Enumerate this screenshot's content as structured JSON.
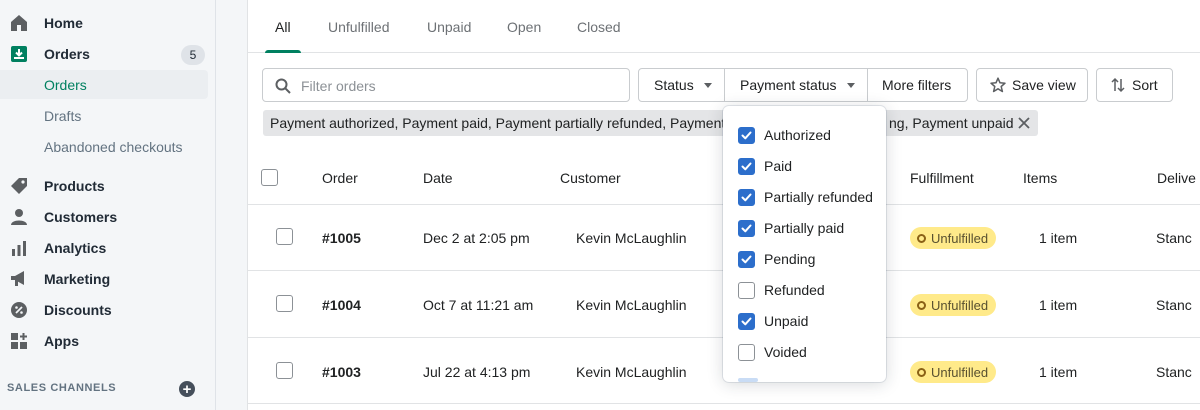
{
  "sidebar": {
    "items": [
      {
        "icon": "home-icon",
        "label": "Home"
      },
      {
        "icon": "orders-icon",
        "label": "Orders",
        "badge": "5"
      },
      {
        "icon": "products-icon",
        "label": "Products"
      },
      {
        "icon": "customers-icon",
        "label": "Customers"
      },
      {
        "icon": "analytics-icon",
        "label": "Analytics"
      },
      {
        "icon": "marketing-icon",
        "label": "Marketing"
      },
      {
        "icon": "discounts-icon",
        "label": "Discounts"
      },
      {
        "icon": "apps-icon",
        "label": "Apps"
      }
    ],
    "order_subitems": [
      "Orders",
      "Drafts",
      "Abandoned checkouts"
    ],
    "channels_label": "SALES CHANNELS"
  },
  "tabs": [
    "All",
    "Unfulfilled",
    "Unpaid",
    "Open",
    "Closed"
  ],
  "active_tab": "All",
  "search": {
    "placeholder": "Filter orders"
  },
  "filters": {
    "status": "Status",
    "payment_status": "Payment status",
    "more_filters": "More filters",
    "save_view": "Save view",
    "sort": "Sort"
  },
  "applied_filter": {
    "text_left": "Payment authorized, Payment paid, Payment partially refunded, Payment pa",
    "text_right": "ng, Payment unpaid"
  },
  "table": {
    "columns": [
      "Order",
      "Date",
      "Customer",
      "Fulfillment",
      "Items",
      "Delive"
    ],
    "rows": [
      {
        "order": "#1005",
        "date": "Dec 2 at 2:05 pm",
        "customer": "Kevin McLaughlin",
        "fulfillment": "Unfulfilled",
        "items": "1 item",
        "delivery": "Stanc"
      },
      {
        "order": "#1004",
        "date": "Oct 7 at 11:21 am",
        "customer": "Kevin McLaughlin",
        "fulfillment": "Unfulfilled",
        "items": "1 item",
        "delivery": "Stanc"
      },
      {
        "order": "#1003",
        "date": "Jul 22 at 4:13 pm",
        "customer": "Kevin McLaughlin",
        "fulfillment": "Unfulfilled",
        "items": "1 item",
        "delivery": "Stanc"
      }
    ]
  },
  "payment_options": [
    {
      "label": "Authorized",
      "checked": true
    },
    {
      "label": "Paid",
      "checked": true
    },
    {
      "label": "Partially refunded",
      "checked": true
    },
    {
      "label": "Partially paid",
      "checked": true
    },
    {
      "label": "Pending",
      "checked": true
    },
    {
      "label": "Refunded",
      "checked": false
    },
    {
      "label": "Unpaid",
      "checked": true
    },
    {
      "label": "Voided",
      "checked": false
    }
  ],
  "colors": {
    "accent_green": "#008060",
    "checkbox_blue": "#2c6ecb",
    "unfulfilled_badge": "#ffea8a"
  }
}
